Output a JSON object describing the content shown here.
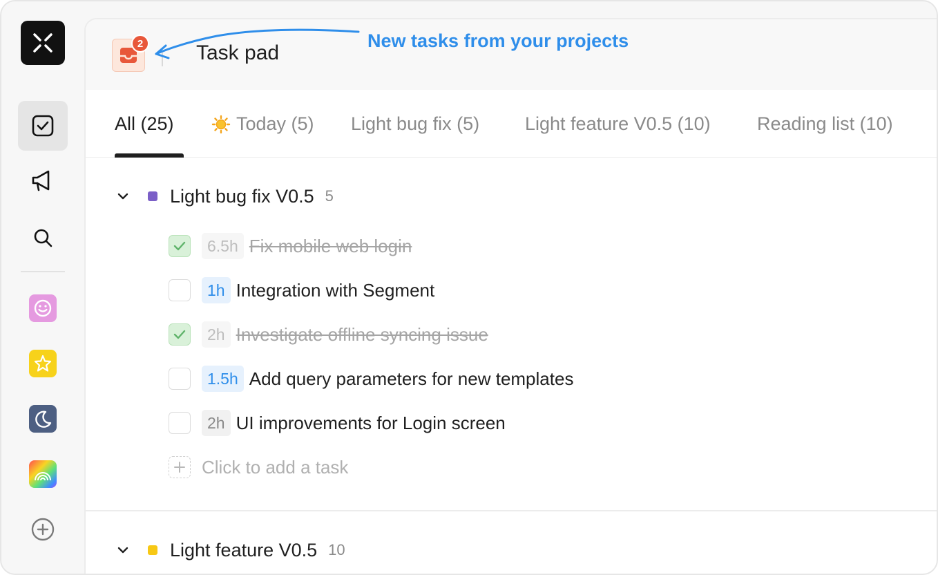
{
  "header": {
    "title": "Task pad",
    "inbox_badge": "2",
    "annotation": "New tasks from your projects"
  },
  "tabs": [
    {
      "label": "All (25)",
      "active": true
    },
    {
      "label": "Today (5)",
      "icon": "sun-icon"
    },
    {
      "label": "Light bug fix (5)"
    },
    {
      "label": "Light feature V0.5 (10)"
    },
    {
      "label": "Reading list (10)"
    }
  ],
  "sidebar": {
    "nav": [
      {
        "icon": "task-check-icon",
        "active": true
      },
      {
        "icon": "megaphone-icon"
      },
      {
        "icon": "search-icon"
      }
    ],
    "projects": [
      {
        "icon": "smiley-icon",
        "color": "#e59ae0"
      },
      {
        "icon": "star-icon",
        "color": "#f7d21b"
      },
      {
        "icon": "moon-icon",
        "color": "#4d5f82"
      },
      {
        "icon": "rainbow-icon",
        "color": "rainbow"
      }
    ],
    "add_icon": "plus-circle-icon"
  },
  "groups": [
    {
      "title": "Light bug fix V0.5",
      "count": "5",
      "color": "#7b5fc7",
      "tasks": [
        {
          "estimate": "6.5h",
          "title": "Fix mobile web login",
          "done": true
        },
        {
          "estimate": "1h",
          "title": "Integration with Segment",
          "done": false
        },
        {
          "estimate": "2h",
          "title": "Investigate offline syncing issue",
          "done": true
        },
        {
          "estimate": "1.5h",
          "title": "Add query parameters for new templates",
          "done": false
        },
        {
          "estimate": "2h",
          "title": "UI improvements for Login screen",
          "done": false
        }
      ],
      "add_placeholder": "Click to add a task"
    },
    {
      "title": "Light feature V0.5",
      "count": "10",
      "color": "#f7c815"
    }
  ],
  "colors": {
    "accent_blue": "#2f8eea",
    "badge_red": "#e8573a",
    "done_green": "#d9f1d9"
  }
}
